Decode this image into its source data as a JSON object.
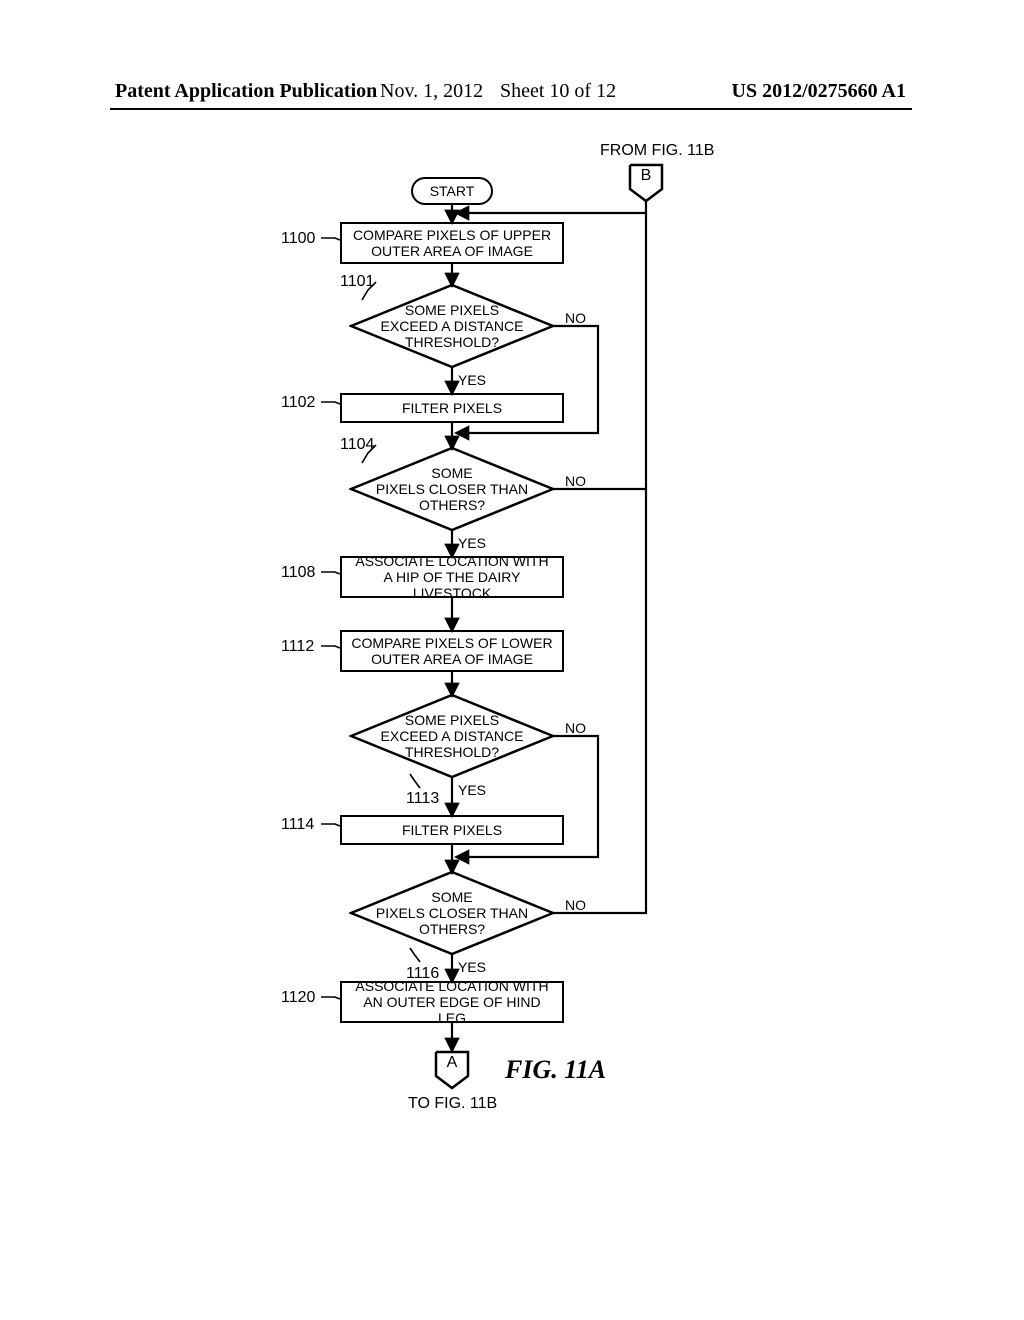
{
  "header": {
    "left": "Patent Application Publication",
    "date": "Nov. 1, 2012",
    "sheet": "Sheet 10 of 12",
    "right": "US 2012/0275660 A1"
  },
  "connectors": {
    "from_fig": "FROM FIG. 11B",
    "to_fig": "TO FIG. 11B",
    "B": "B",
    "A": "A"
  },
  "start": "START",
  "refs": {
    "r1100": "1100",
    "r1101": "1101",
    "r1102": "1102",
    "r1104": "1104",
    "r1108": "1108",
    "r1112": "1112",
    "r1113": "1113",
    "r1114": "1114",
    "r1116": "1116",
    "r1120": "1120"
  },
  "steps": {
    "compare_upper": "COMPARE PIXELS OF UPPER OUTER AREA OF IMAGE",
    "dec_threshold_upper_l1": "SOME PIXELS",
    "dec_threshold_upper_l2": "EXCEED A DISTANCE",
    "dec_threshold_upper_l3": "THRESHOLD?",
    "filter_upper": "FILTER PIXELS",
    "dec_closer_upper_l1": "SOME",
    "dec_closer_upper_l2": "PIXELS CLOSER THAN",
    "dec_closer_upper_l3": "OTHERS?",
    "assoc_hip": "ASSOCIATE LOCATION WITH A HIP OF THE DAIRY LIVESTOCK",
    "compare_lower": "COMPARE PIXELS OF LOWER OUTER AREA OF IMAGE",
    "dec_threshold_lower_l1": "SOME PIXELS",
    "dec_threshold_lower_l2": "EXCEED A DISTANCE",
    "dec_threshold_lower_l3": "THRESHOLD?",
    "filter_lower": "FILTER PIXELS",
    "dec_closer_lower_l1": "SOME",
    "dec_closer_lower_l2": "PIXELS CLOSER THAN",
    "dec_closer_lower_l3": "OTHERS?",
    "assoc_leg": "ASSOCIATE LOCATION WITH AN OUTER EDGE OF HIND LEG"
  },
  "branch": {
    "yes": "YES",
    "no": "NO"
  },
  "figure_label": "FIG. 11A",
  "chart_data": {
    "type": "flowchart",
    "title": "FIG. 11A",
    "entry": "START",
    "offpage_in": {
      "label": "B",
      "from": "FIG. 11B",
      "joins_after": "START"
    },
    "offpage_out": {
      "label": "A",
      "to": "FIG. 11B",
      "after": "1120"
    },
    "nodes": [
      {
        "id": "start",
        "kind": "terminator",
        "text": "START"
      },
      {
        "id": "1100",
        "kind": "process",
        "text": "COMPARE PIXELS OF UPPER OUTER AREA OF IMAGE"
      },
      {
        "id": "1101",
        "kind": "decision",
        "text": "SOME PIXELS EXCEED A DISTANCE THRESHOLD?"
      },
      {
        "id": "1102",
        "kind": "process",
        "text": "FILTER PIXELS"
      },
      {
        "id": "1104",
        "kind": "decision",
        "text": "SOME PIXELS CLOSER THAN OTHERS?"
      },
      {
        "id": "1108",
        "kind": "process",
        "text": "ASSOCIATE LOCATION WITH A HIP OF THE DAIRY LIVESTOCK"
      },
      {
        "id": "1112",
        "kind": "process",
        "text": "COMPARE PIXELS OF LOWER OUTER AREA OF IMAGE"
      },
      {
        "id": "1113",
        "kind": "decision",
        "text": "SOME PIXELS EXCEED A DISTANCE THRESHOLD?"
      },
      {
        "id": "1114",
        "kind": "process",
        "text": "FILTER PIXELS"
      },
      {
        "id": "1116",
        "kind": "decision",
        "text": "SOME PIXELS CLOSER THAN OTHERS?"
      },
      {
        "id": "1120",
        "kind": "process",
        "text": "ASSOCIATE LOCATION WITH AN OUTER EDGE OF HIND LEG"
      }
    ],
    "edges": [
      {
        "from": "start",
        "to": "1100"
      },
      {
        "from": "B",
        "to": "1100",
        "note": "off-page in, joins arrow above 1100"
      },
      {
        "from": "1100",
        "to": "1101"
      },
      {
        "from": "1101",
        "to": "1102",
        "label": "YES"
      },
      {
        "from": "1101",
        "to": "1104",
        "label": "NO",
        "note": "bypass 1102, merge before 1104"
      },
      {
        "from": "1102",
        "to": "1104"
      },
      {
        "from": "1104",
        "to": "1108",
        "label": "YES"
      },
      {
        "from": "1104",
        "to": "1100",
        "label": "NO",
        "note": "loop back to top via right rail"
      },
      {
        "from": "1108",
        "to": "1112"
      },
      {
        "from": "1112",
        "to": "1113"
      },
      {
        "from": "1113",
        "to": "1114",
        "label": "YES"
      },
      {
        "from": "1113",
        "to": "1116",
        "label": "NO",
        "note": "bypass 1114, merge before 1116"
      },
      {
        "from": "1114",
        "to": "1116"
      },
      {
        "from": "1116",
        "to": "1120",
        "label": "YES"
      },
      {
        "from": "1116",
        "to": "1100",
        "label": "NO",
        "note": "loop back to top via right rail"
      },
      {
        "from": "1120",
        "to": "A"
      }
    ]
  }
}
